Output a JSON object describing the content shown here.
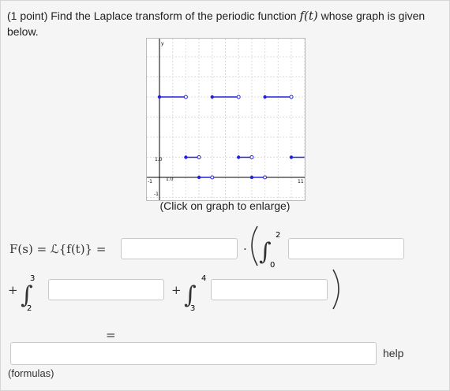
{
  "problem": {
    "prefix": "(1 point) Find the Laplace transform of the periodic function ",
    "func": "f(t)",
    "suffix": " whose graph is given below."
  },
  "graph": {
    "caption": "(Click on graph to enlarge)",
    "y_label": "y",
    "x_label": "t",
    "tick_neg1_x": "-1",
    "tick_neg1_y": "-1",
    "tick_11": "11",
    "tick_1x": "1.0",
    "tick_1y": "1.0",
    "pieces": [
      {
        "from": 0,
        "to": 2,
        "value": 4
      },
      {
        "from": 2,
        "to": 3,
        "value": 1
      },
      {
        "from": 3,
        "to": 4,
        "value": 0
      },
      {
        "from": 4,
        "to": 6,
        "value": 4
      },
      {
        "from": 6,
        "to": 7,
        "value": 1
      },
      {
        "from": 7,
        "to": 8,
        "value": 0
      },
      {
        "from": 8,
        "to": 10,
        "value": 4
      },
      {
        "from": 10,
        "to": 11,
        "value": 1
      }
    ],
    "accent_color": "#2222dd"
  },
  "equation": {
    "lhs": "F(s) = ℒ{f(t)} =",
    "dot": "·",
    "plus": "+",
    "equals": "=",
    "int1": {
      "lower": "0",
      "upper": "2"
    },
    "int2": {
      "lower": "2",
      "upper": "3"
    },
    "int3": {
      "lower": "3",
      "upper": "4"
    }
  },
  "inputs": {
    "coef": "",
    "integrand1": "",
    "integrand2": "",
    "integrand3": "",
    "final": ""
  },
  "links": {
    "help": "help",
    "formulas": "(formulas)"
  }
}
